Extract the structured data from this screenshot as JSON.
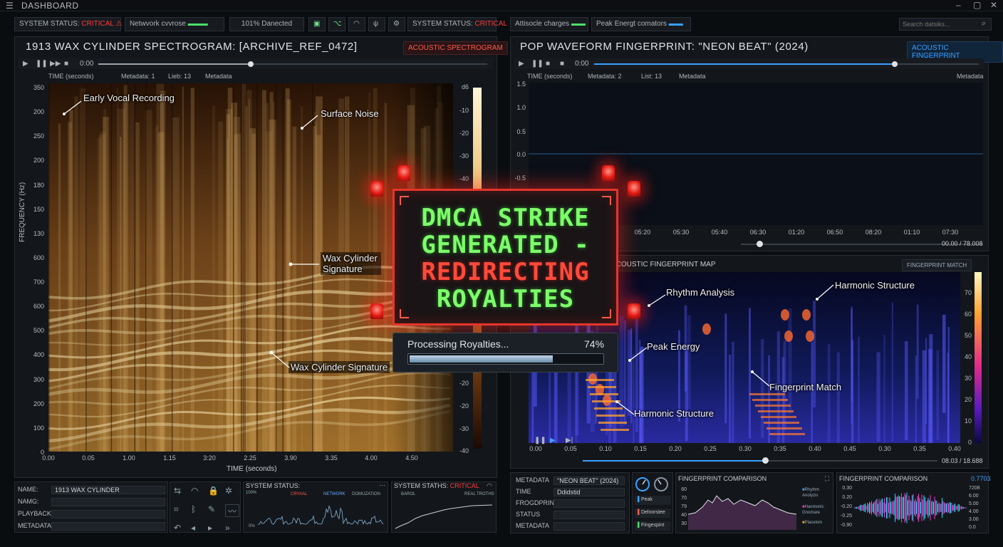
{
  "titlebar": {
    "title": "DASHBOARD"
  },
  "left_status": {
    "system_status_label": "SYSTEM STATUS:",
    "system_status_value": "CRITICAL",
    "network": "Netwvork cvvrose",
    "connection": "101% Danected",
    "system_status_label2": "SYSTEM STATUS:",
    "system_status_value2": "CRITICAL"
  },
  "right_status": {
    "item1": "Attisocle charges",
    "item2": "Peak Energt comators",
    "search_placeholder": "Search datsiks..."
  },
  "left_panel": {
    "title": "1913 WAX CYLINDER SPECTROGRAM: [ARCHIVE_REF_0472]",
    "badge": "ACOUSTIC SPECTROGRAM",
    "time": "0:00",
    "meta_bar": [
      "TIME (seconds)",
      "Metadata: 1",
      "Lieb: 13",
      "Metadata"
    ],
    "y_ticks": [
      "350",
      "200",
      "250",
      "200",
      "180",
      "150",
      "130",
      "600",
      "700",
      "600",
      "500",
      "400",
      "300",
      "200",
      "100",
      "0"
    ],
    "y_label": "FREQUENCY (Hz)",
    "x_ticks": [
      "0.00",
      "0.05",
      "1.00",
      "1.15",
      "3:20",
      "2.25",
      "3.90",
      "3.35",
      "4.00",
      "4.50"
    ],
    "x_label": "TIME (seconds)",
    "db_ticks": [
      "d6",
      "-10",
      "-20",
      "-30",
      "-40",
      "-20",
      "-20",
      "-30",
      "-40"
    ],
    "annotations": [
      "Early Vocal Recording",
      "Surface Noise",
      "Wax Cylinder Signature",
      "Wax Cylinder Signature"
    ],
    "fields": [
      {
        "label": "NAME:",
        "value": "1913 WAX CYLINDER"
      },
      {
        "label": "NAMG:",
        "value": ""
      },
      {
        "label": "PLAYBACK",
        "value": ""
      },
      {
        "label": "METADATA",
        "value": ""
      }
    ],
    "system_status_box": {
      "title": "SYSTEM STATUS:",
      "legend": [
        "CRYAAL",
        "NETWORK",
        "DOMUZATION"
      ],
      "y_ticks": [
        "100%",
        "0%"
      ]
    },
    "system_status_box2": {
      "title": "SYSTEM STATHS:",
      "value": "CRITICAL",
      "legend": [
        "BAROL",
        "REAL TROTHS"
      ]
    }
  },
  "right_panel": {
    "title": "POP WAVEFORM FINGERPRINT: \"NEON BEAT\" (2024)",
    "badge": "ACOUSTIC FINGERPRINT",
    "time": "0:00",
    "meta_bar": [
      "TIME (seconds)",
      "Metadata: 2",
      "List: 13",
      "Metadata",
      "Metadata"
    ],
    "wave_y_ticks": [
      "1.5",
      "1.0",
      "0.5",
      "0.0",
      "-0.5"
    ],
    "wave_x_ticks": [
      "05:20",
      "05:30",
      "05:40",
      "06:30",
      "01:20",
      "06:50",
      "08:20",
      "01:10",
      "07:30"
    ],
    "wave_time": "00.00 / 78.008",
    "fp_title": "ACOUSTIC FINGERPRINT MAP",
    "fp_badge": "FINGERPRINT MATCH",
    "fp_annotations": [
      "Rhythm Analysis",
      "Harmonic Structure",
      "Peak Energy",
      "Fingerprint Match",
      "Harmonic Structure"
    ],
    "fp_x_ticks": [
      "0.00",
      "0.05",
      "0.10",
      "0.15",
      "0.20",
      "0.25",
      "0.30",
      "0:35",
      "0.40",
      "0.45",
      "0.30",
      "0.35",
      "0.40"
    ],
    "fp_scale": [
      "70",
      "60",
      "50",
      "40",
      "30",
      "20",
      "10",
      "0"
    ],
    "fp_time": "08.03 / 18.688",
    "meta_fields": [
      {
        "label": "METADATA",
        "value": "\"NEON BEAT\" (2024)"
      },
      {
        "label": "TIME",
        "value": "Ddidstid"
      },
      {
        "label": "FROGDPRINT",
        "value": ""
      },
      {
        "label": "STATUS",
        "value": ""
      },
      {
        "label": "METADATA",
        "value": ""
      }
    ],
    "gauge_legend": [
      "Peak",
      "Delnorstee",
      "Fingespint"
    ],
    "comp1": {
      "title": "FINGERPRINT COMPARISON",
      "y": [
        "60",
        "70",
        "79",
        "40",
        "30"
      ],
      "legend": [
        "Rhythm Anolyzis",
        "Hanmonic Gnomare",
        "Placelom"
      ]
    },
    "comp2": {
      "title": "FINGERPRINT COMPARISON",
      "value": "0.7703",
      "y": [
        "0.30",
        "0.20",
        "-0.20",
        "-0.25",
        "-0.90"
      ],
      "y2": [
        "7208",
        "6.00",
        "5.00",
        "4.00",
        "3.00",
        "0.0"
      ]
    }
  },
  "overlay": {
    "line1": "DMCA STRIKE",
    "line2": "GENERATED -",
    "line3": "REDIRECTING",
    "line4": "ROYALTIES",
    "progress_label": "Processing Royalties...",
    "progress_value": "74%",
    "progress_fraction": 0.74
  },
  "colors": {
    "critical": "#ff3b3b",
    "accent_blue": "#3aa0ff",
    "alert_red": "#e5352b",
    "green_text": "#7dff6a"
  }
}
